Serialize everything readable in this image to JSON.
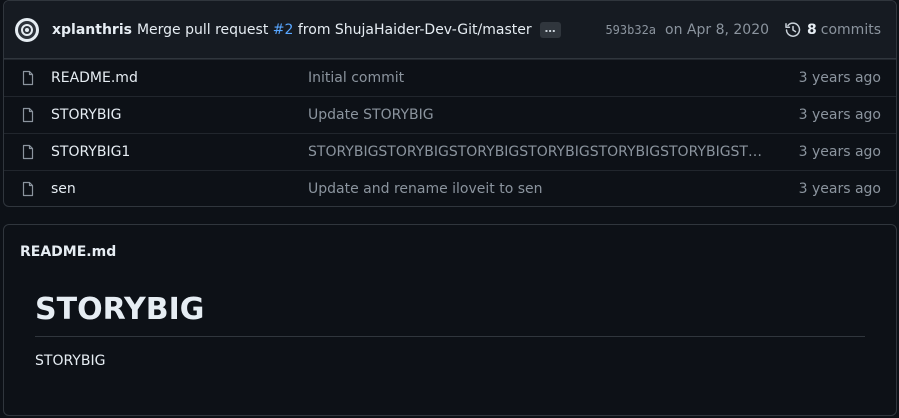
{
  "latest_commit": {
    "author": "xplanthris",
    "message_prefix": "Merge pull request",
    "pr_link": "#2",
    "message_suffix": "from ShujaHaider-Dev-Git/master",
    "ellipsis": "…",
    "sha": "593b32a",
    "date": "on Apr 8, 2020",
    "commit_count": "8",
    "commits_label": "commits"
  },
  "files": [
    {
      "name": "README.md",
      "message": "Initial commit",
      "age": "3 years ago"
    },
    {
      "name": "STORYBIG",
      "message": "Update STORYBIG",
      "age": "3 years ago"
    },
    {
      "name": "STORYBIG1",
      "message": "STORYBIGSTORYBIGSTORYBIGSTORYBIGSTORYBIGSTORYBIGSTORY…",
      "age": "3 years ago"
    },
    {
      "name": "sen",
      "message": "Update and rename iloveit to sen",
      "age": "3 years ago"
    }
  ],
  "readme": {
    "title": "README.md",
    "heading": "STORYBIG",
    "body": "STORYBIG"
  }
}
